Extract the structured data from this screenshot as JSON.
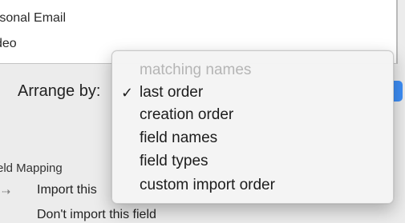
{
  "field_list": {
    "items": [
      "rsonal Email",
      "deo"
    ]
  },
  "arrange": {
    "label": "Arrange by:"
  },
  "menu": {
    "check_glyph": "✓",
    "items": [
      {
        "label": "matching names",
        "enabled": false,
        "checked": false
      },
      {
        "label": "last order",
        "enabled": true,
        "checked": true
      },
      {
        "label": "creation order",
        "enabled": true,
        "checked": false
      },
      {
        "label": "field names",
        "enabled": true,
        "checked": false
      },
      {
        "label": "field types",
        "enabled": true,
        "checked": false
      },
      {
        "label": "custom import order",
        "enabled": true,
        "checked": false
      }
    ]
  },
  "mapping": {
    "section_label": "eld Mapping",
    "arrow_glyph": "⇢",
    "rows": [
      "Import this",
      "Don't import this field"
    ]
  },
  "colors": {
    "accent": "#3d8ef7",
    "menu_bg": "#f4f4f4",
    "disabled_text": "#b5b5b5"
  }
}
